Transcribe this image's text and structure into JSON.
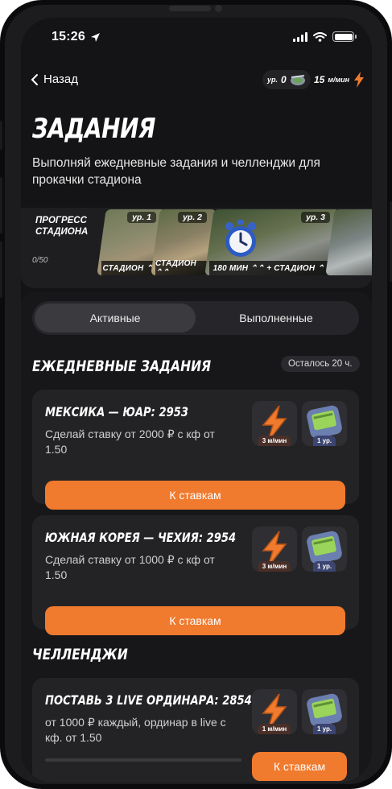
{
  "status": {
    "time": "15:26"
  },
  "nav": {
    "back_label": "Назад"
  },
  "level_pill": {
    "prefix": "ур.",
    "value": "0"
  },
  "speed_pill": {
    "value": "15",
    "unit": "м/мин"
  },
  "page": {
    "title": "ЗАДАНИЯ",
    "subtitle": "Выполняй ежедневные задания и челленджи для прокачки стадиона"
  },
  "stadium_progress": {
    "label": "ПРОГРЕСС СТАДИОНА",
    "count": "0/50",
    "tiles": [
      {
        "level": "ур. 1",
        "caption": "СТАДИОН ⌃⌃"
      },
      {
        "level": "ур. 2",
        "caption": "СТАДИОН ⌃⌃"
      },
      {
        "level": "ур. 3",
        "caption": "180 МИН ⌃⌃ + СТАДИОН ⌃⌃"
      },
      {
        "level": "",
        "caption": ""
      }
    ]
  },
  "tabs": {
    "active": "Активные",
    "done": "Выполненные"
  },
  "daily": {
    "title": "ЕЖЕДНЕВНЫЕ ЗАДАНИЯ",
    "remaining": "Осталось 20 ч.",
    "tasks": [
      {
        "title": "МЕКСИКА — ЮАР: 2953",
        "desc": "Сделай ставку от 2000 ₽ с кф от 1.50",
        "reward_speed": "3 м/мин",
        "reward_level": "1 ур.",
        "button": "К ставкам"
      },
      {
        "title": "ЮЖНАЯ КОРЕЯ — ЧЕХИЯ: 2954",
        "desc": "Сделай ставку от 1000 ₽ с кф от 1.50",
        "reward_speed": "3 м/мин",
        "reward_level": "1 ур.",
        "button": "К ставкам"
      }
    ]
  },
  "challenges": {
    "title": "ЧЕЛЛЕНДЖИ",
    "tasks": [
      {
        "title": "ПОСТАВЬ 3 LIVE ОРДИНАРА: 2854",
        "desc": "от 1000 ₽ каждый, ординар в live с кф. от 1.50",
        "reward_speed": "1 м/мин",
        "reward_level": "1 ур.",
        "button": "К ставкам"
      }
    ]
  },
  "colors": {
    "accent": "#f07a2e",
    "background": "#141416",
    "card": "#232326"
  }
}
